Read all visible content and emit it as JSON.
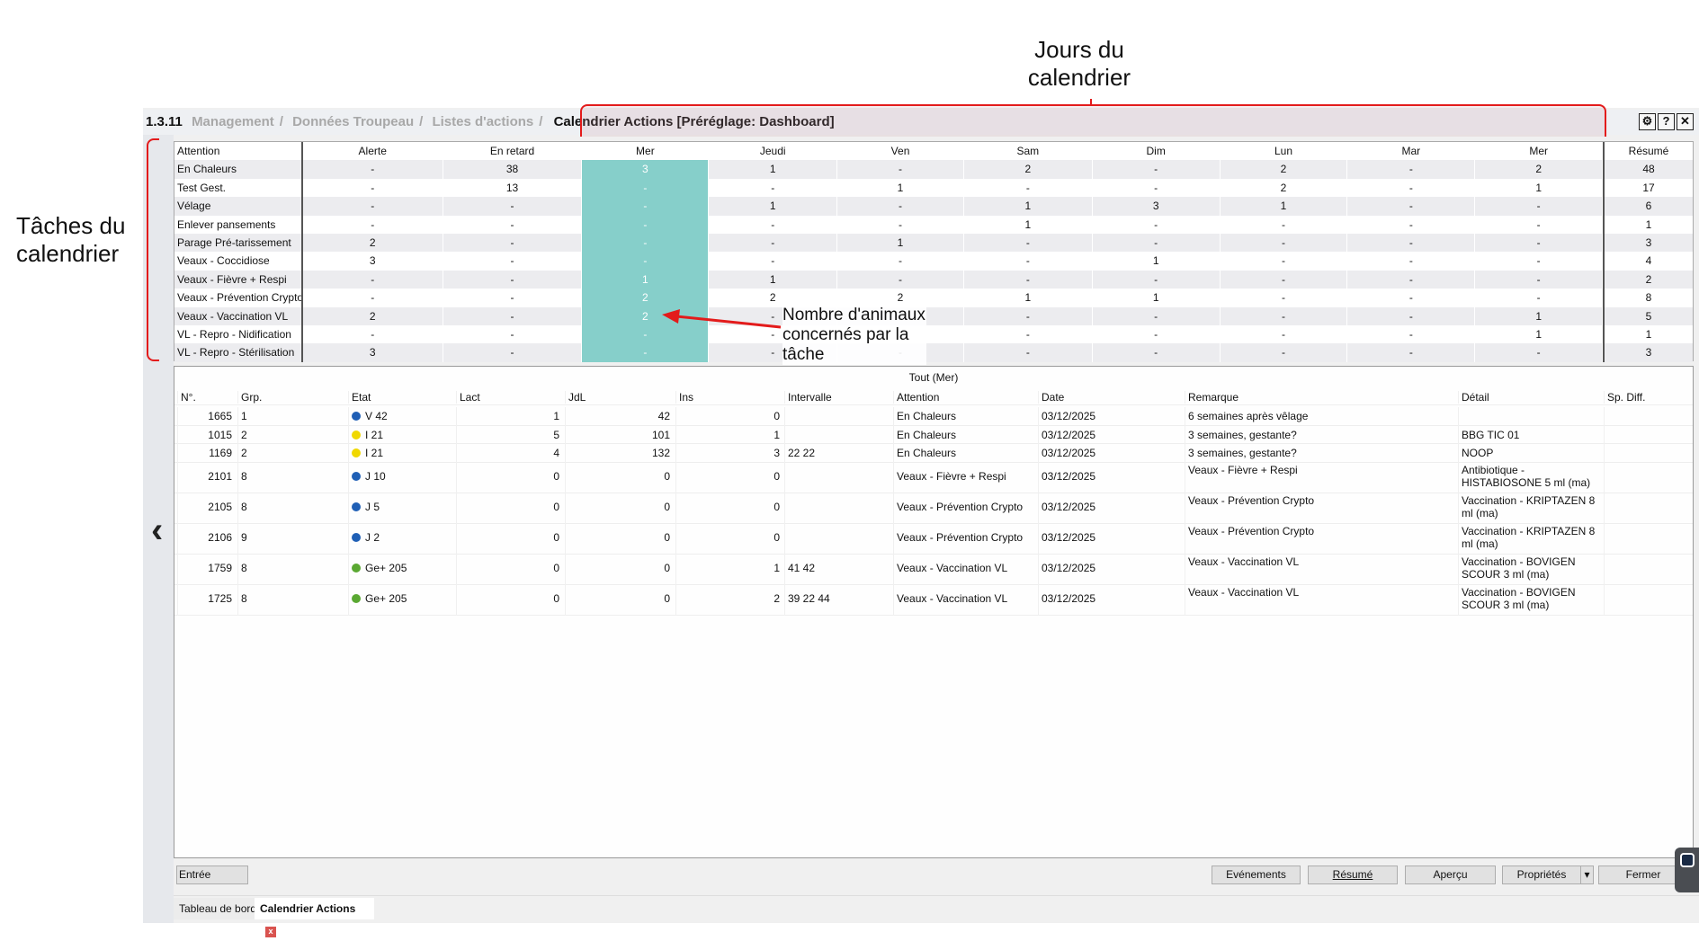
{
  "annotations": {
    "days": "Jours du calendrier",
    "tasks": "Tâches du calendrier",
    "count": "Nombre d'animaux concernés par la tâche"
  },
  "titlebar": {
    "version": "1.3.11",
    "crumbs": [
      "Management",
      "Données Troupeau",
      "Listes d'actions"
    ],
    "current": "Calendrier Actions [Préréglage: Dashboard]",
    "icons": [
      "gear-icon",
      "help-icon",
      "close-icon"
    ],
    "gear": "⚙",
    "help": "?",
    "close": "✕"
  },
  "calendar": {
    "columns": [
      "Attention",
      "Alerte",
      "En retard",
      "Mer",
      "Jeudi",
      "Ven",
      "Sam",
      "Dim",
      "Lun",
      "Mar",
      "Mer",
      "Résumé"
    ],
    "today_index": 3,
    "today_color": "#86cfca",
    "rows": [
      [
        "En Chaleurs",
        "-",
        "38",
        "3",
        "1",
        "-",
        "2",
        "-",
        "2",
        "-",
        "2",
        "48"
      ],
      [
        "Test Gest.",
        "-",
        "13",
        "-",
        "-",
        "1",
        "-",
        "-",
        "2",
        "-",
        "1",
        "17"
      ],
      [
        "Vélage",
        "-",
        "-",
        "-",
        "1",
        "-",
        "1",
        "3",
        "1",
        "-",
        "-",
        "6"
      ],
      [
        "Enlever pansements",
        "-",
        "-",
        "-",
        "-",
        "-",
        "1",
        "-",
        "-",
        "-",
        "-",
        "1"
      ],
      [
        "Parage Pré-tarissement",
        "2",
        "-",
        "-",
        "-",
        "1",
        "-",
        "-",
        "-",
        "-",
        "-",
        "3"
      ],
      [
        "Veaux - Coccidiose",
        "3",
        "-",
        "-",
        "-",
        "-",
        "-",
        "1",
        "-",
        "-",
        "-",
        "4"
      ],
      [
        "Veaux - Fièvre + Respi",
        "-",
        "-",
        "1",
        "1",
        "-",
        "-",
        "-",
        "-",
        "-",
        "-",
        "2"
      ],
      [
        "Veaux - Prévention Crypto",
        "-",
        "-",
        "2",
        "2",
        "2",
        "1",
        "1",
        "-",
        "-",
        "-",
        "8"
      ],
      [
        "Veaux - Vaccination VL",
        "2",
        "-",
        "2",
        "-",
        "-",
        "-",
        "-",
        "-",
        "-",
        "1",
        "5"
      ],
      [
        "VL - Repro - Nidification",
        "-",
        "-",
        "-",
        "-",
        "-",
        "-",
        "-",
        "-",
        "-",
        "1",
        "1"
      ],
      [
        "VL - Repro - Stérilisation",
        "3",
        "-",
        "-",
        "-",
        "-",
        "-",
        "-",
        "-",
        "-",
        "-",
        "3"
      ]
    ]
  },
  "list": {
    "title": "Tout (Mer)",
    "columns": [
      "N°.",
      "Grp.",
      "Etat",
      "Lact",
      "JdL",
      "Ins",
      "Intervalle",
      "Attention",
      "Date",
      "Remarque",
      "Détail",
      "Sp. Diff."
    ],
    "rows": [
      {
        "no": "1665",
        "grp": "1",
        "dot": "#1f5fb5",
        "etat": "V 42",
        "lact": "1",
        "jdl": "42",
        "ins": "0",
        "intervalle": "",
        "attention": "En Chaleurs",
        "date": "03/12/2025",
        "remarque": "6 semaines après vêlage",
        "detail": "",
        "spdiff": ""
      },
      {
        "no": "1015",
        "grp": "2",
        "dot": "#f0d800",
        "etat": "I 21",
        "lact": "5",
        "jdl": "101",
        "ins": "1",
        "intervalle": "",
        "attention": "En Chaleurs",
        "date": "03/12/2025",
        "remarque": "3 semaines, gestante?",
        "detail": "BBG TIC 01",
        "spdiff": ""
      },
      {
        "no": "1169",
        "grp": "2",
        "dot": "#f0d800",
        "etat": "I 21",
        "lact": "4",
        "jdl": "132",
        "ins": "3",
        "intervalle": "22 22",
        "attention": "En Chaleurs",
        "date": "03/12/2025",
        "remarque": "3 semaines, gestante?",
        "detail": "NOOP",
        "spdiff": ""
      },
      {
        "no": "2101",
        "grp": "8",
        "dot": "#1f5fb5",
        "etat": "J 10",
        "lact": "0",
        "jdl": "0",
        "ins": "0",
        "intervalle": "",
        "attention": "Veaux - Fièvre + Respi",
        "date": "03/12/2025",
        "remarque": "Veaux - Fièvre + Respi",
        "detail": "Antibiotique - HISTABIOSONE 5 ml (ma)",
        "spdiff": ""
      },
      {
        "no": "2105",
        "grp": "8",
        "dot": "#1f5fb5",
        "etat": "J 5",
        "lact": "0",
        "jdl": "0",
        "ins": "0",
        "intervalle": "",
        "attention": "Veaux - Prévention Crypto",
        "date": "03/12/2025",
        "remarque": "Veaux - Prévention Crypto",
        "detail": "Vaccination - KRIPTAZEN 8 ml (ma)",
        "spdiff": ""
      },
      {
        "no": "2106",
        "grp": "9",
        "dot": "#1f5fb5",
        "etat": "J 2",
        "lact": "0",
        "jdl": "0",
        "ins": "0",
        "intervalle": "",
        "attention": "Veaux - Prévention Crypto",
        "date": "03/12/2025",
        "remarque": "Veaux - Prévention Crypto",
        "detail": "Vaccination - KRIPTAZEN 8 ml (ma)",
        "spdiff": ""
      },
      {
        "no": "1759",
        "grp": "8",
        "dot": "#5aa832",
        "etat": "Ge+ 205",
        "lact": "0",
        "jdl": "0",
        "ins": "1",
        "intervalle": "41 42",
        "attention": "Veaux - Vaccination VL",
        "date": "03/12/2025",
        "remarque": "Veaux - Vaccination VL",
        "detail": "Vaccination - BOVIGEN SCOUR 3 ml (ma)",
        "spdiff": ""
      },
      {
        "no": "1725",
        "grp": "8",
        "dot": "#5aa832",
        "etat": "Ge+ 205",
        "lact": "0",
        "jdl": "0",
        "ins": "2",
        "intervalle": "39 22 44",
        "attention": "Veaux - Vaccination VL",
        "date": "03/12/2025",
        "remarque": "Veaux - Vaccination VL",
        "detail": "Vaccination - BOVIGEN SCOUR 3 ml (ma)",
        "spdiff": ""
      }
    ]
  },
  "footer": {
    "group_entry": "Entrée groupée",
    "events": "Evénements",
    "summary": "Résumé",
    "preview": "Aperçu",
    "properties": "Propriétés",
    "dropdown": "▾",
    "close": "Fermer"
  },
  "tabs": {
    "dashboard": "Tableau de bord",
    "calendar": "Calendrier Actions",
    "close": "x"
  },
  "nav": {
    "back": "‹"
  }
}
